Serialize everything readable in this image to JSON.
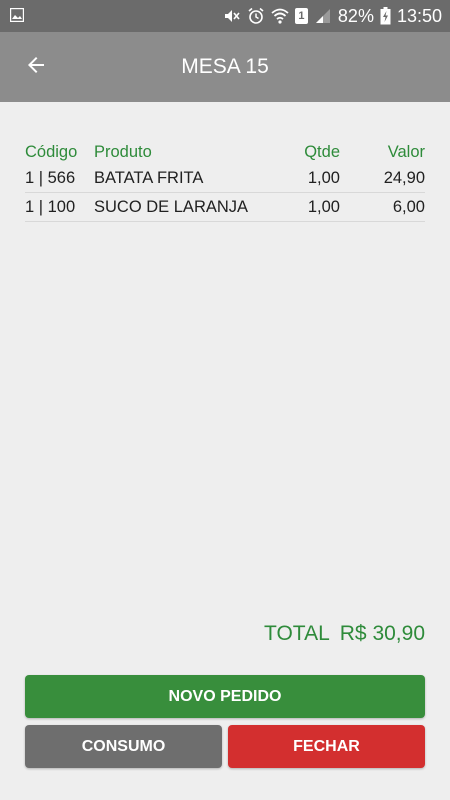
{
  "status_bar": {
    "battery": "82%",
    "time": "13:50",
    "sim": "1",
    "icons": [
      "gallery-icon",
      "mute-icon",
      "alarm-icon",
      "wifi-icon",
      "sim-icon",
      "signal-icon",
      "battery-charging-icon"
    ]
  },
  "app_bar": {
    "title": "MESA 15",
    "back_icon": "arrow-back-icon"
  },
  "table": {
    "headers": {
      "code": "Código",
      "product": "Produto",
      "qty": "Qtde",
      "value": "Valor"
    },
    "rows": [
      {
        "code": "1 | 566",
        "product": "BATATA FRITA",
        "qty": "1,00",
        "value": "24,90"
      },
      {
        "code": "1 | 100",
        "product": "SUCO DE LARANJA",
        "qty": "1,00",
        "value": "6,00"
      }
    ]
  },
  "total": {
    "label": "TOTAL",
    "value": "R$ 30,90"
  },
  "buttons": {
    "novo_pedido": "NOVO PEDIDO",
    "consumo": "CONSUMO",
    "fechar": "FECHAR"
  },
  "colors": {
    "accent_green": "#2e8b3a",
    "button_green": "#388e3c",
    "button_gray": "#6e6e6e",
    "button_red": "#d32f2f",
    "app_bar": "#8c8c8c"
  }
}
